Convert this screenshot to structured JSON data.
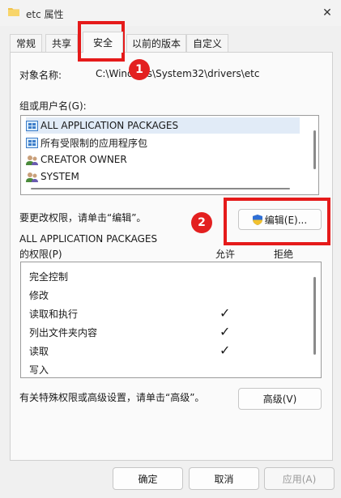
{
  "window": {
    "title": "etc 属性",
    "close_label": "✕"
  },
  "tabs": [
    {
      "label": "常规"
    },
    {
      "label": "共享"
    },
    {
      "label": "安全",
      "active": true
    },
    {
      "label": "以前的版本"
    },
    {
      "label": "自定义"
    }
  ],
  "security": {
    "object_name_label": "对象名称:",
    "object_name_value": "C:\\Windows\\System32\\drivers\\etc",
    "groups_label": "组或用户名(G):",
    "groups": [
      {
        "name": "ALL APPLICATION PACKAGES",
        "icon": "app-packages-icon",
        "selected": true
      },
      {
        "name": "所有受限制的应用程序包",
        "icon": "app-packages-icon"
      },
      {
        "name": "CREATOR OWNER",
        "icon": "users-icon"
      },
      {
        "name": "SYSTEM",
        "icon": "users-icon"
      }
    ],
    "edit_hint": "要更改权限，请单击“编辑”。",
    "edit_button": "编辑(E)...",
    "permissions_for_line1": "ALL APPLICATION PACKAGES",
    "permissions_for_line2": "的权限(P)",
    "allow_header": "允许",
    "deny_header": "拒绝",
    "permissions": [
      {
        "name": "完全控制",
        "allow": false
      },
      {
        "name": "修改",
        "allow": false
      },
      {
        "name": "读取和执行",
        "allow": true
      },
      {
        "name": "列出文件夹内容",
        "allow": true
      },
      {
        "name": "读取",
        "allow": true
      },
      {
        "name": "写入",
        "allow": false
      }
    ],
    "advanced_hint": "有关特殊权限或高级设置，请单击“高级”。",
    "advanced_button": "高级(V)"
  },
  "footer": {
    "ok": "确定",
    "cancel": "取消",
    "apply": "应用(A)"
  },
  "annotations": {
    "badge1": "1",
    "badge2": "2",
    "highlight_color": "#e51a1a"
  },
  "colors": {
    "selection": "#e1ebf7",
    "shield_blue": "#2f6fd6",
    "shield_yellow": "#f2c12e"
  }
}
